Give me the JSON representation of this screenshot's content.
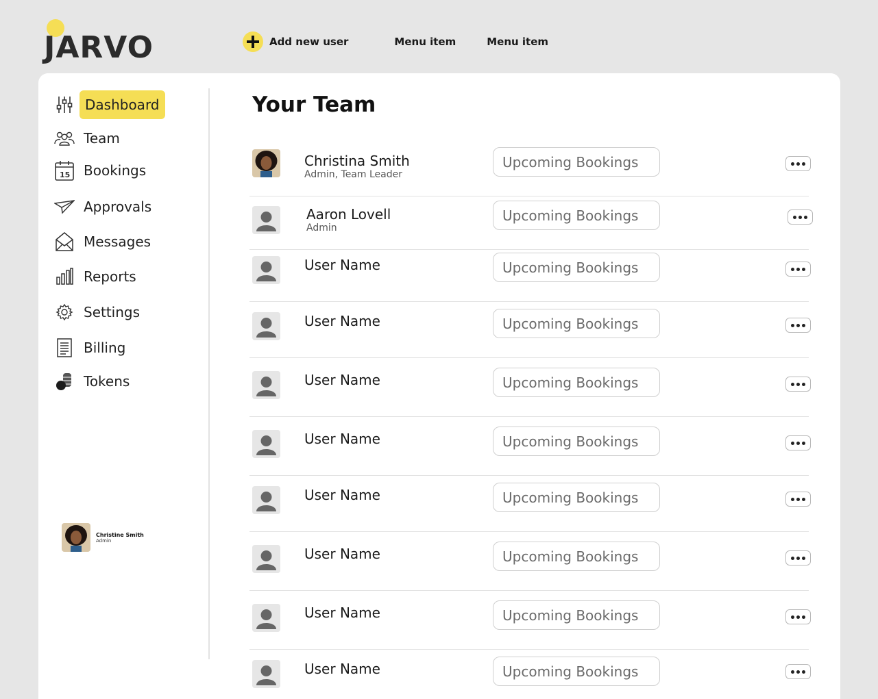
{
  "brand": {
    "logo_text": "JARVO",
    "accent_color": "#f5de55"
  },
  "header": {
    "add_user_label": "Add new user",
    "menu_items": [
      "Menu item",
      "Menu item"
    ]
  },
  "sidebar": {
    "items": [
      {
        "label": "Dashboard",
        "icon": "sliders-icon",
        "active": true
      },
      {
        "label": "Team",
        "icon": "team-icon"
      },
      {
        "label": "Bookings",
        "icon": "calendar-icon",
        "badge": "15"
      },
      {
        "label": "Approvals",
        "icon": "paper-plane-icon"
      },
      {
        "label": "Messages",
        "icon": "envelope-icon"
      },
      {
        "label": "Reports",
        "icon": "bar-chart-icon"
      },
      {
        "label": "Settings",
        "icon": "gear-icon"
      },
      {
        "label": "Billing",
        "icon": "receipt-icon"
      },
      {
        "label": "Tokens",
        "icon": "coins-icon"
      }
    ],
    "profile": {
      "name": "Christine Smith",
      "role": "Admin"
    }
  },
  "main": {
    "title": "Your Team",
    "bookings_label": "Upcoming Bookings",
    "rows": [
      {
        "name": "Christina Smith",
        "role": "Admin, Team Leader",
        "photo": true
      },
      {
        "name": "Aaron Lovell",
        "role": "Admin",
        "photo": false
      },
      {
        "name": "User Name",
        "role": "",
        "photo": false
      },
      {
        "name": "User Name",
        "role": "",
        "photo": false
      },
      {
        "name": "User Name",
        "role": "",
        "photo": false
      },
      {
        "name": "User Name",
        "role": "",
        "photo": false
      },
      {
        "name": "User Name",
        "role": "",
        "photo": false
      },
      {
        "name": "User Name",
        "role": "",
        "photo": false
      },
      {
        "name": "User Name",
        "role": "",
        "photo": false
      },
      {
        "name": "User Name",
        "role": "",
        "photo": false
      }
    ]
  }
}
